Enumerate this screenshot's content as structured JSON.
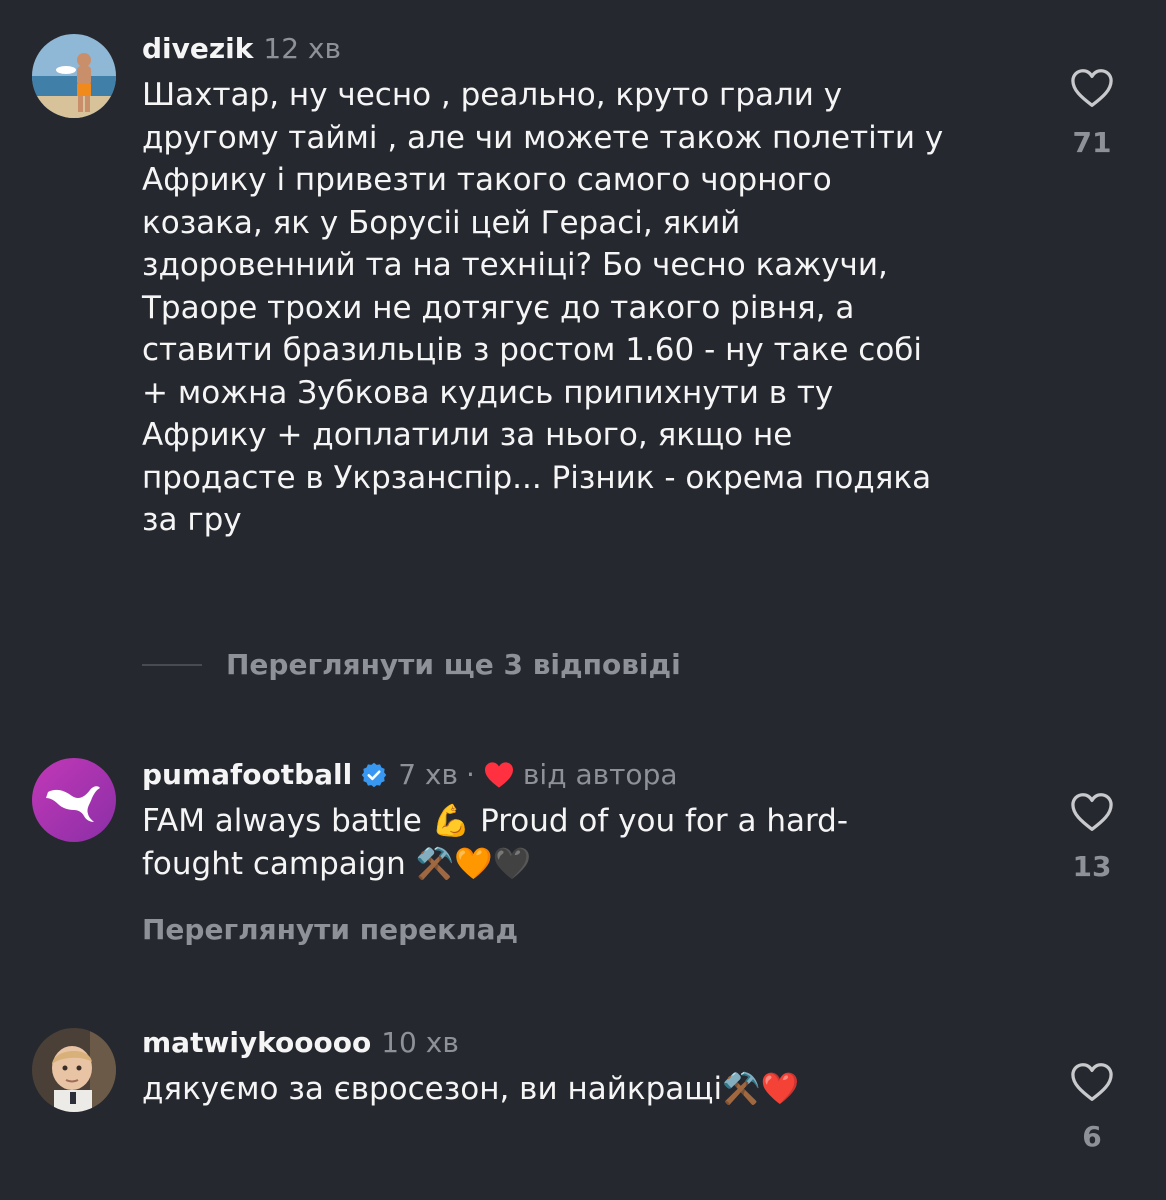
{
  "comments": [
    {
      "username": "divezik",
      "time": "12 хв",
      "text": "Шахтар, ну чесно , реально, круто грали у\nдругому таймі , але чи можете також полетіти у\nАфрику і привезти такого самого чорного\nкозака, як у Борусіі цей Герасі, який\nздоровенний та на техніці? Бо чесно кажучи,\nТраоре трохи не дотягує до такого рівня, а\nставити бразильців з ростом 1.60 - ну таке собі\n+ можна Зубкова кудись припихнути в ту\nАфрику + доплатили за нього,  якщо не\nпродасте в Укрзанспір... Різник - окрема подяка\nза гру",
      "likes": "71",
      "replies_label": "Переглянути ще 3 відповіді"
    },
    {
      "username": "pumafootball",
      "time": "7 хв",
      "separator": "·",
      "author_like_label": "від автора",
      "text_line1": "FAM always battle 💪 Proud of you for a hard-",
      "text_line2": "fought campaign ⚒️🧡🖤",
      "likes": "13",
      "translate_label": "Переглянути переклад"
    },
    {
      "username": "matwiykooooo",
      "time": "10 хв",
      "text": "дякуємо за євросезон, ви найкращі⚒️❤️",
      "likes": "6"
    }
  ],
  "colors": {
    "background": "#25282e",
    "primary_text": "#f5f5f5",
    "secondary_text": "#8e9198",
    "verified_blue": "#3897f0",
    "author_heart": "#ff3040"
  }
}
